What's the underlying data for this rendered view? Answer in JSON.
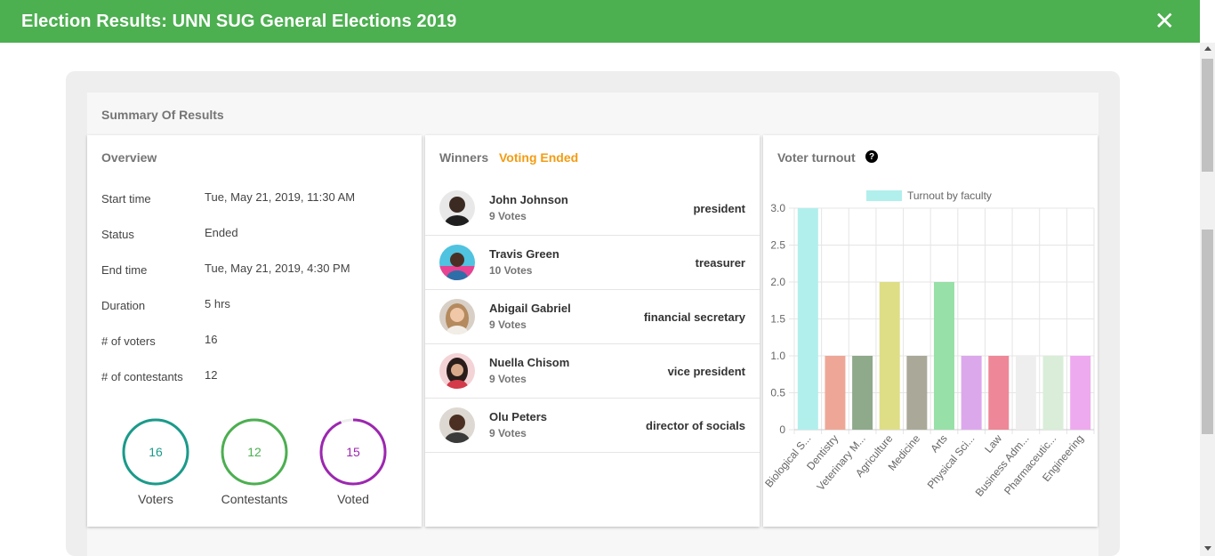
{
  "header": {
    "title": "Election Results: UNN SUG General Elections 2019",
    "close_icon": "close-icon"
  },
  "summary": {
    "title": "Summary Of Results"
  },
  "overview": {
    "title": "Overview",
    "rows": [
      {
        "label": "Start time",
        "value": "Tue, May 21, 2019, 11:30 AM"
      },
      {
        "label": "Status",
        "value": "Ended"
      },
      {
        "label": "End time",
        "value": "Tue, May 21, 2019, 4:30 PM"
      },
      {
        "label": "Duration",
        "value": "5 hrs"
      },
      {
        "label": "# of voters",
        "value": "16"
      },
      {
        "label": "# of contestants",
        "value": "12"
      }
    ],
    "circles": [
      {
        "value": "16",
        "label": "Voters",
        "color": "#1b9a8a",
        "fraction": 1.0
      },
      {
        "value": "12",
        "label": "Contestants",
        "color": "#4caf50",
        "fraction": 1.0
      },
      {
        "value": "15",
        "label": "Voted",
        "color": "#9c27b0",
        "fraction": 0.9375
      }
    ]
  },
  "winners": {
    "title": "Winners",
    "status": "Voting Ended",
    "items": [
      {
        "name": "John Johnson",
        "votes": "9 Votes",
        "position": "president"
      },
      {
        "name": "Travis Green",
        "votes": "10 Votes",
        "position": "treasurer"
      },
      {
        "name": "Abigail Gabriel",
        "votes": "9 Votes",
        "position": "financial secretary"
      },
      {
        "name": "Nuella Chisom",
        "votes": "9 Votes",
        "position": "vice president"
      },
      {
        "name": "Olu Peters",
        "votes": "9 Votes",
        "position": "director of socials"
      }
    ]
  },
  "turnout": {
    "title": "Voter turnout",
    "help_icon": "question-circle-icon"
  },
  "chart_data": {
    "type": "bar",
    "legend": "Turnout by faculty",
    "legend_position": "top-center",
    "categories": [
      "Biological S...",
      "Dentistry",
      "Veterinary M...",
      "Agriculture",
      "Medicine",
      "Arts",
      "Physical Sci...",
      "Law",
      "Business Adm...",
      "Pharmaceutic...",
      "Engineering"
    ],
    "values": [
      3,
      1,
      1,
      2,
      1,
      2,
      1,
      1,
      1,
      1,
      1
    ],
    "colors": [
      "#b1efed",
      "#eea797",
      "#8fa98b",
      "#dede86",
      "#aaa899",
      "#97e0a7",
      "#dca8ec",
      "#ee8797",
      "#eeeeee",
      "#d9edd8",
      "#eeaaee"
    ],
    "yticks": [
      "3.0",
      "2.5",
      "2.0",
      "1.5",
      "1.0",
      "0.5",
      "0"
    ],
    "ylim": [
      0,
      3
    ],
    "grid": true
  }
}
